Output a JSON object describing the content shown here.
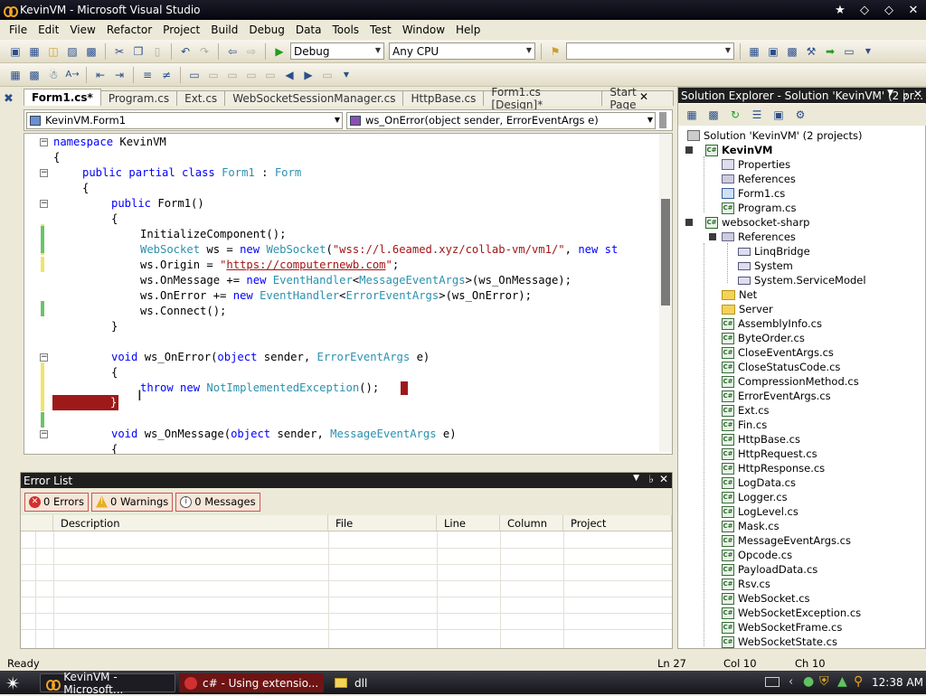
{
  "window": {
    "title": "KevinVM - Microsoft Visual Studio"
  },
  "menu": [
    "File",
    "Edit",
    "View",
    "Refactor",
    "Project",
    "Build",
    "Debug",
    "Data",
    "Tools",
    "Test",
    "Window",
    "Help"
  ],
  "toolbar": {
    "configuration": "Debug",
    "platform": "Any CPU",
    "find_value": ""
  },
  "doc_tabs": [
    "Form1.cs*",
    "Program.cs",
    "Ext.cs",
    "WebSocketSessionManager.cs",
    "HttpBase.cs",
    "Form1.cs [Design]*",
    "Start Page"
  ],
  "nav": {
    "type_dropdown": "KevinVM.Form1",
    "member_dropdown": "ws_OnError(object sender, ErrorEventArgs e)"
  },
  "code": {
    "l1_ns_kw": "namespace",
    "l1_ns_name": " KevinVM",
    "l2": "{",
    "l3_a": "public partial class",
    "l3_b": " Form1 ",
    "l3_c": ": ",
    "l3_d": "Form",
    "l4": "{",
    "l5_a": "public",
    "l5_b": " Form1()",
    "l6": "{",
    "l7": "InitializeComponent();",
    "l8_a": "WebSocket",
    "l8_b": " ws = ",
    "l8_c": "new",
    "l8_d": " ",
    "l8_e": "WebSocket",
    "l8_f": "(",
    "l8_g": "\"wss://l.6eamed.xyz/collab-vm/vm1/\"",
    "l8_h": ", ",
    "l8_i": "new st",
    "l9_a": "ws.Origin = ",
    "l9_b": "\"",
    "l9_c": "https://computernewb.com",
    "l9_d": "\"",
    "l9_e": ";",
    "l10_a": "ws.OnMessage += ",
    "l10_b": "new",
    "l10_c": " ",
    "l10_d": "EventHandler",
    "l10_e": "<",
    "l10_f": "MessageEventArgs",
    "l10_g": ">(ws_OnMessage);",
    "l11_a": "ws.OnError += ",
    "l11_b": "new",
    "l11_c": " ",
    "l11_d": "EventHandler",
    "l11_e": "<",
    "l11_f": "ErrorEventArgs",
    "l11_g": ">(ws_OnError);",
    "l12": "ws.Connect();",
    "l13": "}",
    "l15_a": "void",
    "l15_b": " ws_OnError(",
    "l15_c": "object",
    "l15_d": " sender, ",
    "l15_e": "ErrorEventArgs",
    "l15_f": " e)",
    "l16": "{",
    "l17_a": "throw",
    "l17_b": " ",
    "l17_c": "new",
    "l17_d": " ",
    "l17_e": "NotImplementedException",
    "l17_f": "();",
    "l18": "}",
    "l20_a": "void",
    "l20_b": " ws_OnMessage(",
    "l20_c": "object",
    "l20_d": " sender, ",
    "l20_e": "MessageEventArgs",
    "l20_f": " e)",
    "l21": "{"
  },
  "error_list": {
    "title": "Error List",
    "errors": "0 Errors",
    "warnings": "0 Warnings",
    "messages": "0 Messages",
    "columns": [
      "Description",
      "File",
      "Line",
      "Column",
      "Project"
    ]
  },
  "solution_explorer": {
    "title": "Solution Explorer - Solution 'KevinVM' (2 pr...",
    "solution": "Solution 'KevinVM' (2 projects)",
    "project1": "KevinVM",
    "project1_items": [
      "Properties",
      "References",
      "Form1.cs",
      "Program.cs"
    ],
    "project2": "websocket-sharp",
    "references": "References",
    "refs": [
      "LinqBridge",
      "System",
      "System.ServiceModel"
    ],
    "folders": [
      "Net",
      "Server"
    ],
    "files": [
      "AssemblyInfo.cs",
      "ByteOrder.cs",
      "CloseEventArgs.cs",
      "CloseStatusCode.cs",
      "CompressionMethod.cs",
      "ErrorEventArgs.cs",
      "Ext.cs",
      "Fin.cs",
      "HttpBase.cs",
      "HttpRequest.cs",
      "HttpResponse.cs",
      "LogData.cs",
      "Logger.cs",
      "LogLevel.cs",
      "Mask.cs",
      "MessageEventArgs.cs",
      "Opcode.cs",
      "PayloadData.cs",
      "Rsv.cs",
      "WebSocket.cs",
      "WebSocketException.cs",
      "WebSocketFrame.cs",
      "WebSocketState.cs"
    ]
  },
  "status": {
    "text": "Ready",
    "ln": "Ln 27",
    "col": "Col 10",
    "ch": "Ch 10"
  },
  "taskbar": {
    "tasks": [
      "KevinVM - Microsoft...",
      "c# - Using extensio...",
      "dll"
    ],
    "clock": "12:38 AM"
  }
}
